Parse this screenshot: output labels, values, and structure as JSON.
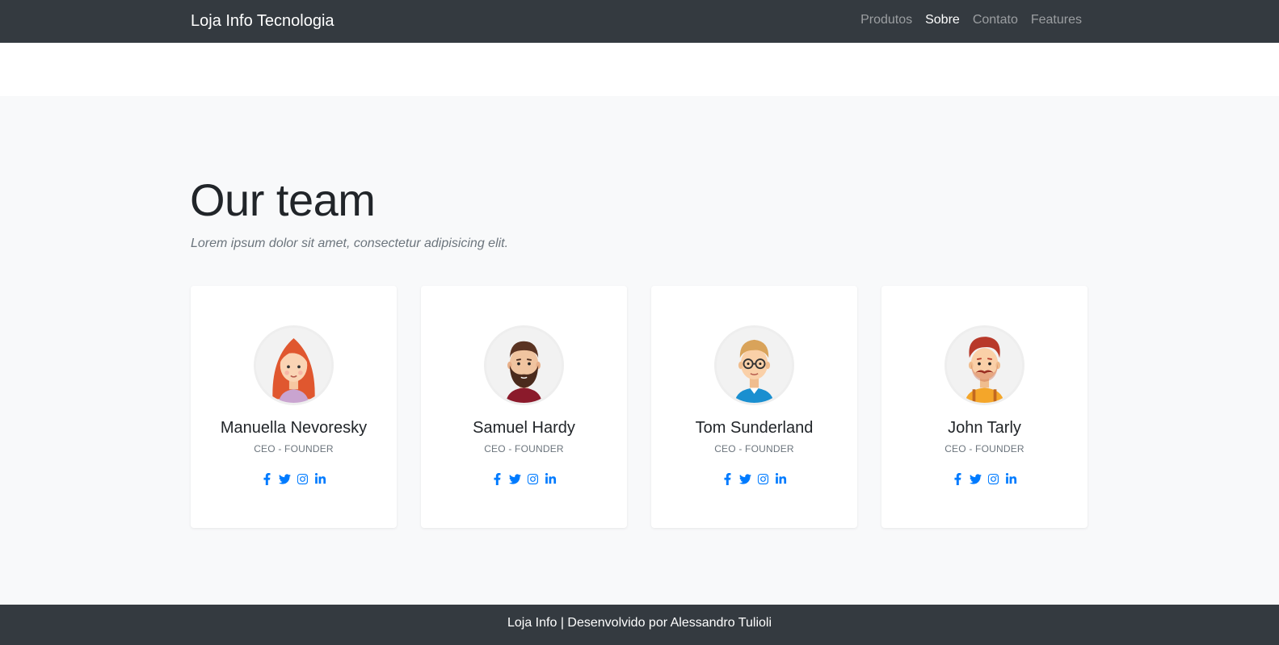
{
  "navbar": {
    "brand": "Loja Info Tecnologia",
    "links": [
      {
        "label": "Produtos",
        "active": false
      },
      {
        "label": "Sobre",
        "active": true
      },
      {
        "label": "Contato",
        "active": false
      },
      {
        "label": "Features",
        "active": false
      }
    ]
  },
  "team": {
    "title": "Our team",
    "subtitle": "Lorem ipsum dolor sit amet, consectetur adipisicing elit.",
    "members": [
      {
        "name": "Manuella Nevoresky",
        "role": "CEO - FOUNDER",
        "avatar": "woman-red-hair-avatar"
      },
      {
        "name": "Samuel Hardy",
        "role": "CEO - FOUNDER",
        "avatar": "bearded-man-avatar"
      },
      {
        "name": "Tom Sunderland",
        "role": "CEO - FOUNDER",
        "avatar": "man-glasses-avatar"
      },
      {
        "name": "John Tarly",
        "role": "CEO - FOUNDER",
        "avatar": "man-mustache-avatar"
      }
    ],
    "social_icons": [
      "facebook-icon",
      "twitter-icon",
      "instagram-icon",
      "linkedin-icon"
    ]
  },
  "footer": {
    "text": "Loja Info | Desenvolvido por Alessandro Tulioli"
  },
  "colors": {
    "navbar_bg": "#343a40",
    "accent": "#007bff",
    "section_bg": "#f8f9fa"
  }
}
